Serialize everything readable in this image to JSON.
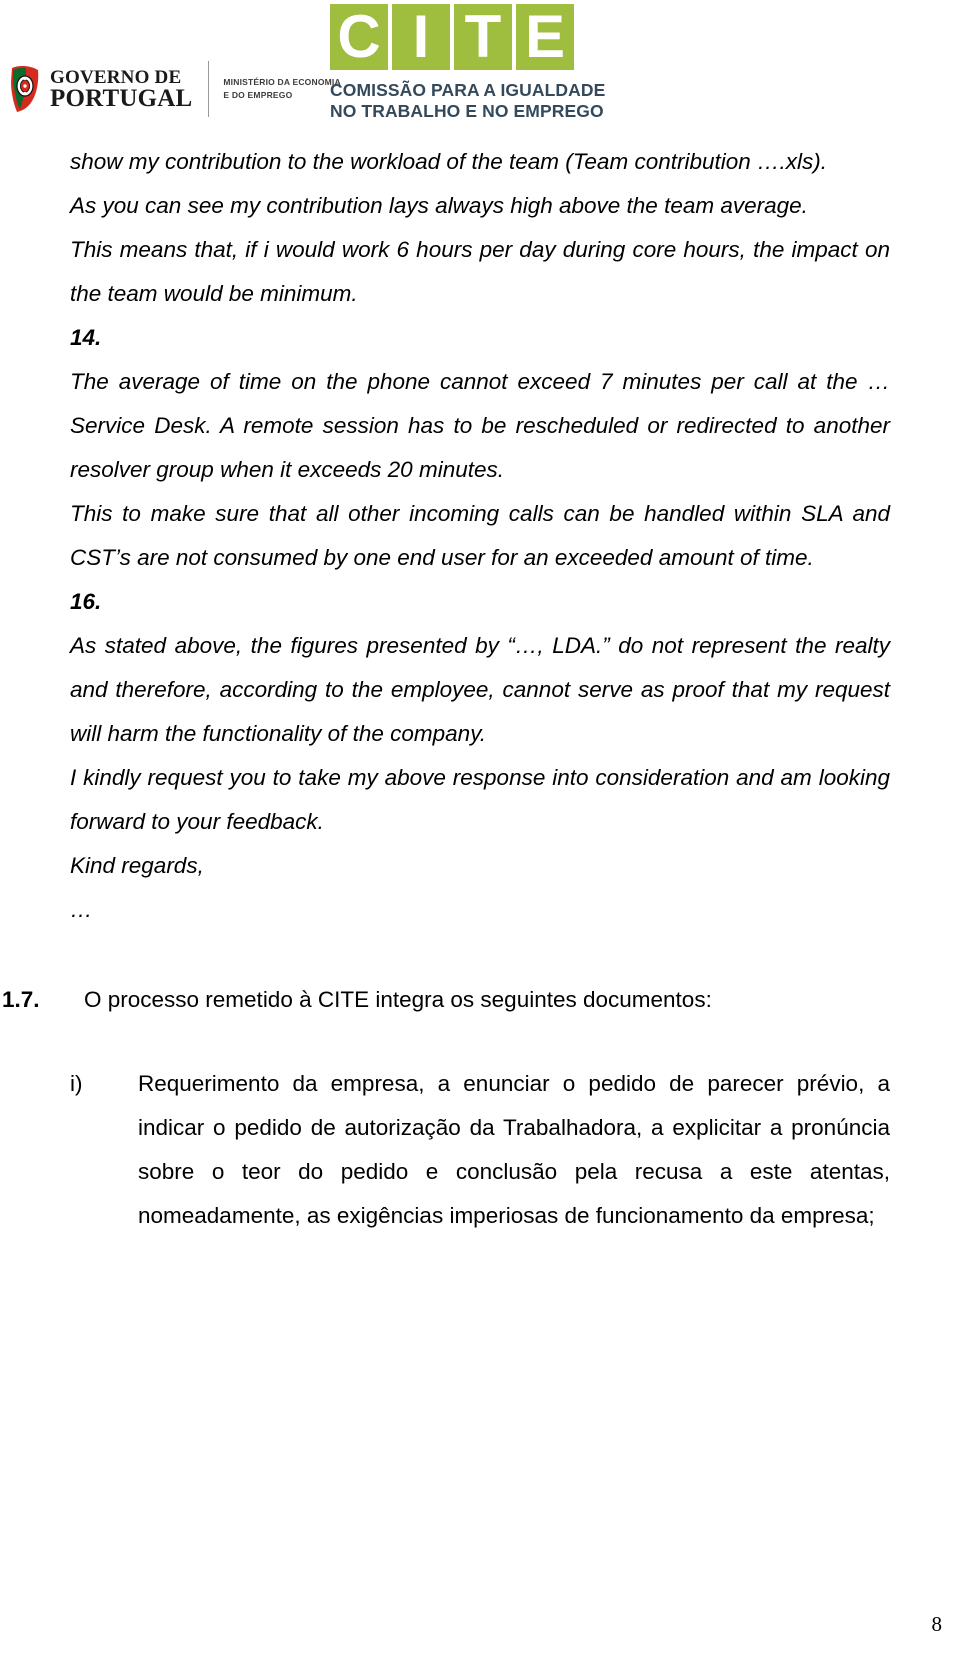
{
  "header": {
    "gov_logo": {
      "line1": "GOVERNO DE",
      "line2": "PORTUGAL",
      "ministry_line1": "MINISTÉRIO DA ECONOMIA",
      "ministry_line2": "E DO EMPREGO",
      "shield_colors": [
        "#D52B1E",
        "#006600",
        "#FFD700"
      ]
    },
    "cite_logo": {
      "letters": [
        "C",
        "I",
        "T",
        "E"
      ],
      "subtitle_line1": "COMISSÃO PARA A IGUALDADE",
      "subtitle_line2": "NO TRABALHO E NO EMPREGO",
      "square_color": "#9FBD3F",
      "subtitle_color": "#34495A"
    }
  },
  "content": {
    "para_1": "show my contribution to the workload of the team (Team contribution ….xls).",
    "para_2": "As you can see my contribution lays always high above the team average.",
    "para_3": "This means that, if i would work 6 hours per day during core hours, the impact on the team would be minimum.",
    "item_14_number": "14.",
    "para_4": "The average of time on the phone cannot exceed 7 minutes per call at the … Service Desk. A remote session has to be rescheduled or redirected to another resolver group when it exceeds 20 minutes.",
    "para_5": "This to make sure that all other incoming calls can be handled within SLA and CST’s are not consumed by one end user for an exceeded amount of time.",
    "item_16_number": "16.",
    "para_6": "As stated above, the figures presented by “…, LDA.” do not represent the realty and therefore, according to the employee, cannot serve as proof that my request will harm the functionality of the company.",
    "para_7": "I kindly request you to take my above response into consideration and am looking forward to your feedback.",
    "para_8": "Kind regards,",
    "para_9": "…",
    "pt_section_number": "1.7.",
    "pt_section_text": "O processo remetido à CITE integra os seguintes documentos:",
    "pt_item_bullet": "i)",
    "pt_item_text": "Requerimento da empresa, a enunciar o pedido de parecer prévio, a indicar o pedido de autorização da Trabalhadora, a explicitar a pronúncia sobre o teor do pedido e conclusão pela recusa a este atentas, nomeadamente, as exigências imperiosas de funcionamento da empresa;"
  },
  "footer": {
    "page_number": "8"
  }
}
